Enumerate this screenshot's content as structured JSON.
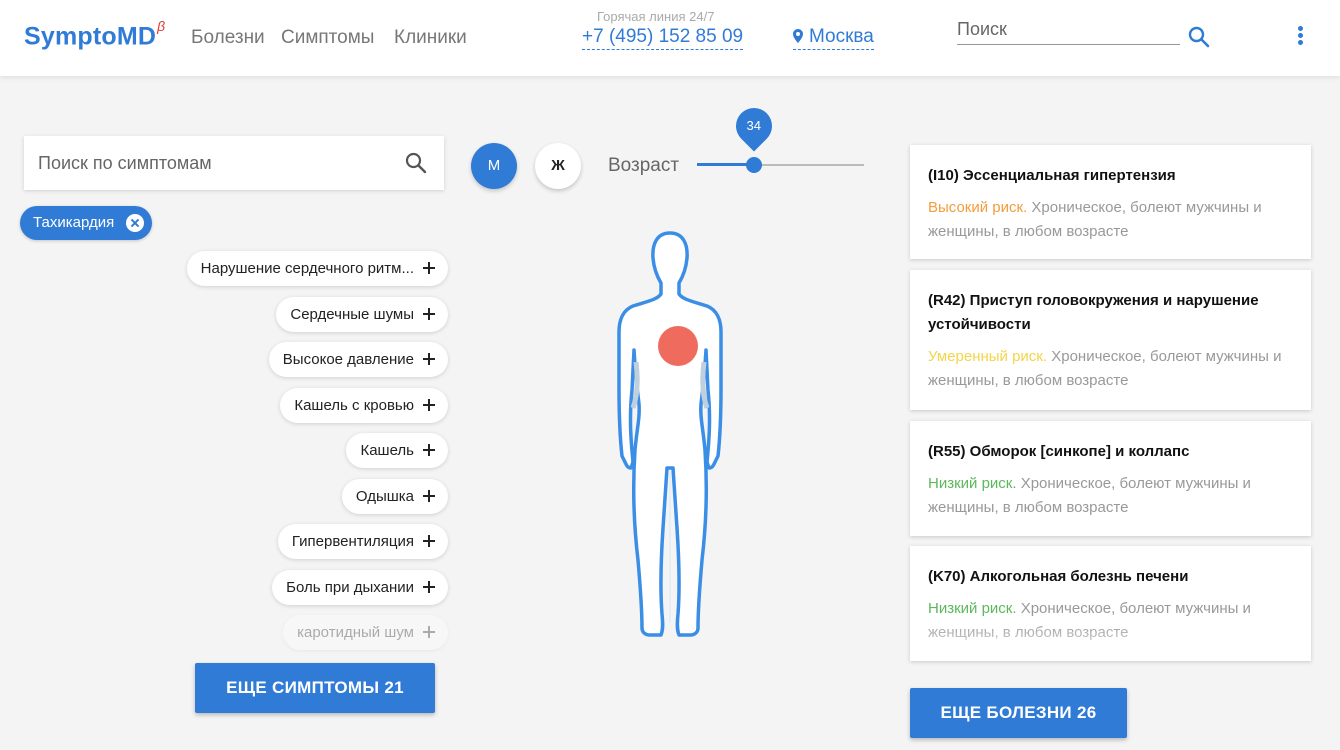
{
  "header": {
    "logo": "SymptoMD",
    "logo_sup": "β",
    "nav": [
      "Болезни",
      "Симптомы",
      "Клиники"
    ],
    "hotline_label": "Горячая линия 24/7",
    "hotline_phone": "+7 (495) 152 85 09",
    "city": "Москва",
    "search_placeholder": "Поиск"
  },
  "symptoms": {
    "search_placeholder": "Поиск по симптомам",
    "selected": "Тахикардия",
    "suggestions": [
      "Нарушение сердечного ритм...",
      "Сердечные шумы",
      "Высокое давление",
      "Кашель с кровью",
      "Кашель",
      "Одышка",
      "Гипервентиляция",
      "Боль при дыхании",
      "каротидный шум"
    ],
    "more_button": "ЕЩЕ СИМПТОМЫ 21"
  },
  "patient": {
    "male_label": "М",
    "female_label": "Ж",
    "age_label": "Возраст",
    "age_value": 34,
    "age_fraction": 0.34,
    "selected_gender": "male"
  },
  "diseases": {
    "cards": [
      {
        "title": "(I10) Эссенциальная гипертензия",
        "risk": "Высокий риск.",
        "risk_level": "high",
        "desc": "Хроническое, болеют мужчины и женщины, в любом возрасте"
      },
      {
        "title": "(R42) Приступ головокружения и нарушение устойчивости",
        "risk": "Умеренный риск.",
        "risk_level": "med",
        "desc": "Хроническое, болеют мужчины и женщины, в любом возрасте"
      },
      {
        "title": "(R55) Обморок [синкопе] и коллапс",
        "risk": "Низкий риск.",
        "risk_level": "low",
        "desc": "Хроническое, болеют мужчины и женщины, в любом возрасте"
      },
      {
        "title": "(K70) Алкогольная болезнь печени",
        "risk": "Низкий риск.",
        "risk_level": "low",
        "desc": "Хроническое, болеют мужчины и женщины, в любом возрасте"
      }
    ],
    "more_button": "ЕЩЕ БОЛЕЗНИ 26"
  },
  "colors": {
    "accent": "#2f7bd6",
    "risk_high": "#f39c3d",
    "risk_med": "#f2d54a",
    "risk_low": "#5cb85c",
    "heart_marker": "#ef6b5e"
  },
  "icons": [
    "search-icon",
    "location-pin-icon",
    "more-vert-icon",
    "close-icon",
    "plus-icon",
    "human-body-figure"
  ]
}
